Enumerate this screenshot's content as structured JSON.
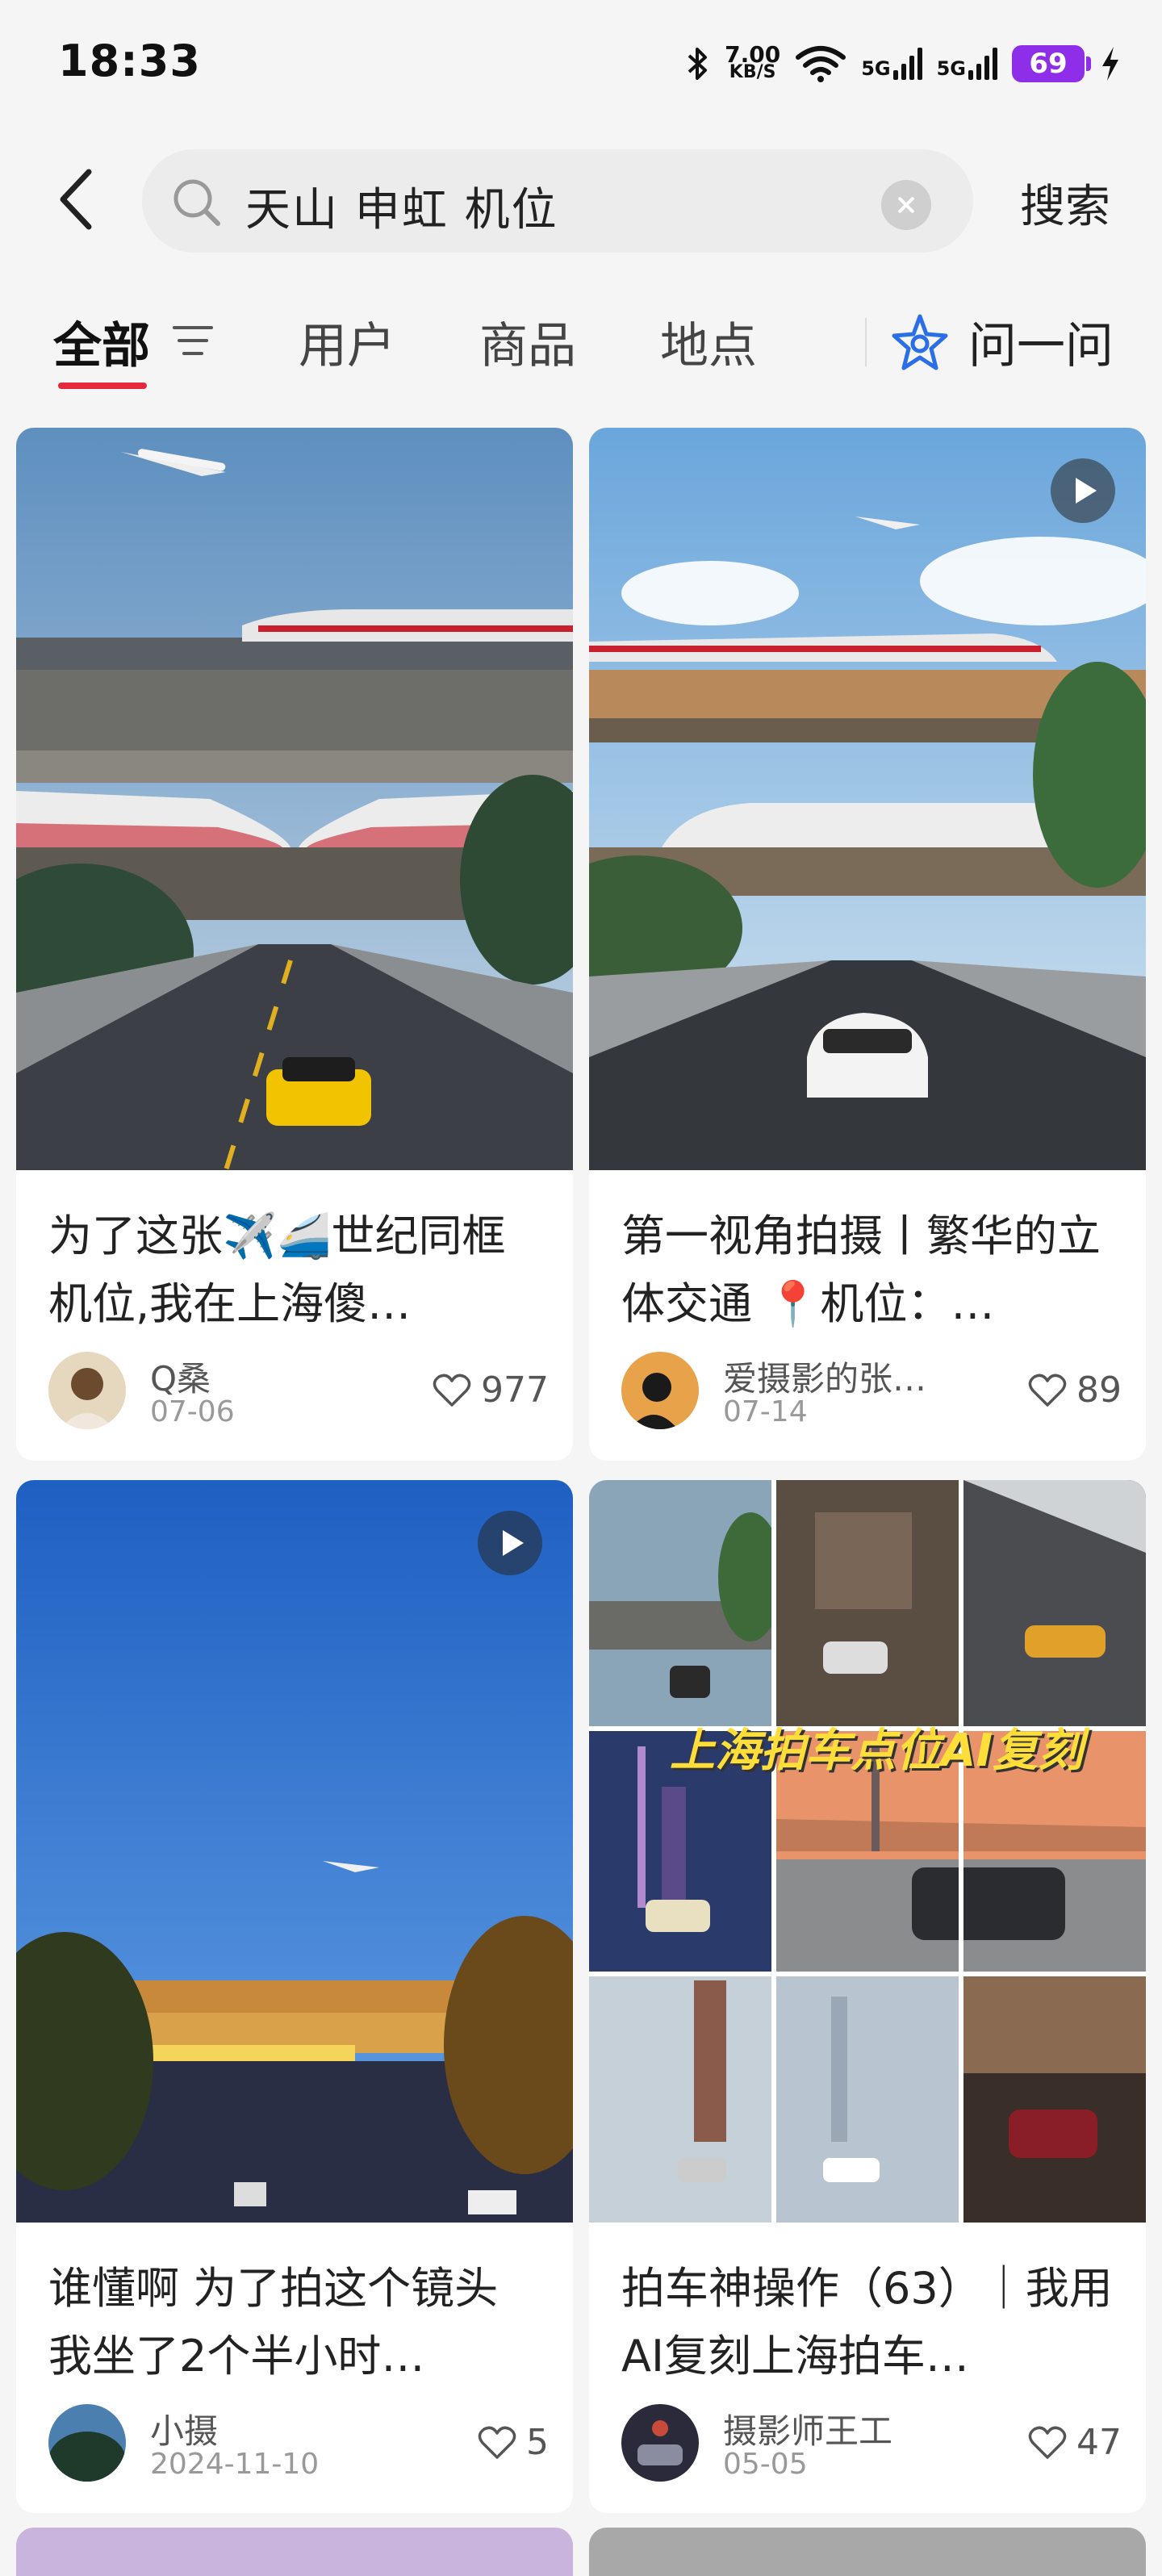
{
  "status_bar": {
    "time": "18:33",
    "net_speed_value": "7.00",
    "net_speed_unit": "KB/S",
    "signal_label_1": "5G",
    "signal_label_2": "5G",
    "battery": "69",
    "icons": [
      "bluetooth-icon",
      "wifi-icon",
      "signal-icon",
      "battery-icon",
      "charging-icon"
    ]
  },
  "search": {
    "query": "天山 申虹 机位",
    "submit_label": "搜索"
  },
  "tabs": [
    {
      "label": "全部",
      "active": true
    },
    {
      "label": "用户",
      "active": false
    },
    {
      "label": "商品",
      "active": false
    },
    {
      "label": "地点",
      "active": false
    }
  ],
  "ask_label": "问一问",
  "colors": {
    "accent": "#e6283c",
    "battery": "#8e2ee8",
    "collage_caption": "#ffde3a"
  },
  "cards": [
    {
      "title": "为了这张✈️🚄世纪同框机位,我在上海傻…",
      "author": "Q桑",
      "date": "07-06",
      "likes": "977",
      "has_video": false
    },
    {
      "title": "第一视角拍摄丨繁华的立体交通 📍机位：…",
      "author": "爱摄影的张…",
      "date": "07-14",
      "likes": "89",
      "has_video": true
    },
    {
      "title": "谁懂啊 为了拍这个镜头 我坐了2个半小时…",
      "author": "小摄",
      "date": "2024-11-10",
      "likes": "5",
      "has_video": true
    },
    {
      "title": "拍车神操作（63）｜我用AI复刻上海拍车…",
      "author": "摄影师王工",
      "date": "05-05",
      "likes": "47",
      "has_video": false,
      "image_caption": "上海拍车点位AI复刻"
    }
  ]
}
